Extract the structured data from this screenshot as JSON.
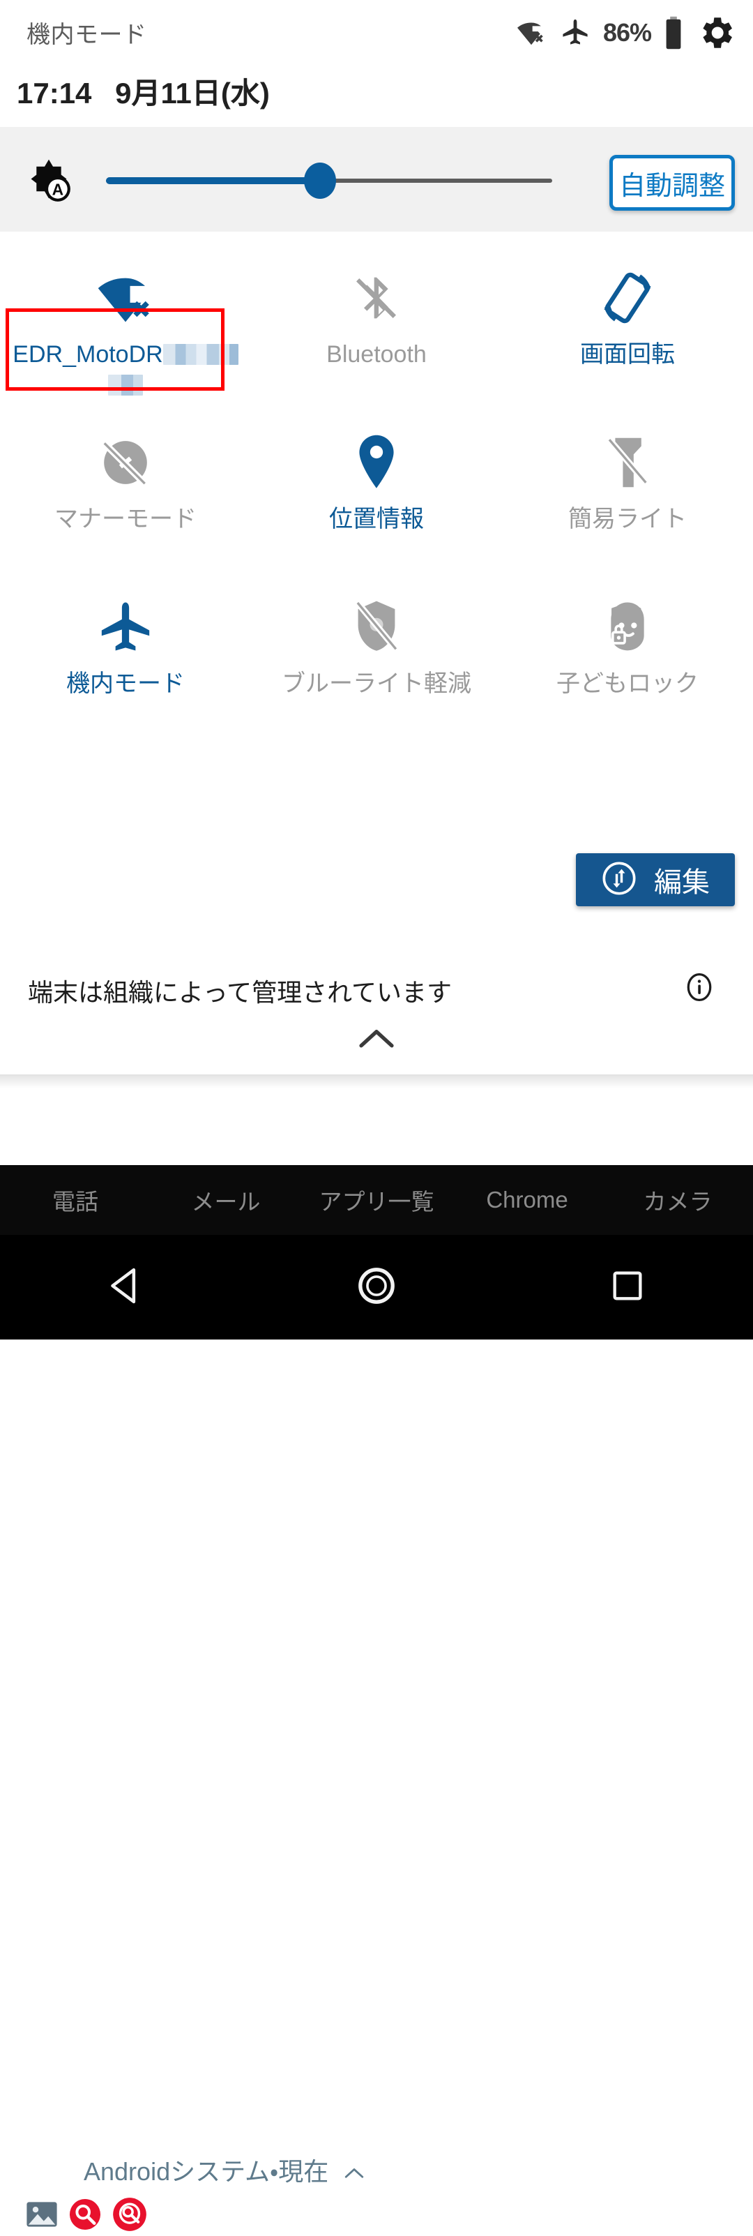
{
  "status_bar": {
    "left_label": "機内モード",
    "battery_percent": "86%",
    "icons": [
      "wifi-off-icon",
      "airplane-icon",
      "battery-icon",
      "gear-icon"
    ]
  },
  "clock": {
    "time": "17:14",
    "date": "9月11日(水)"
  },
  "brightness": {
    "icon": "auto-brightness-icon",
    "slider_value": 48,
    "auto_button_label": "自動調整"
  },
  "colors": {
    "accent_blue": "#0d5a96",
    "accent_blue_light": "#0d7ac4",
    "edit_button_blue": "#15568f",
    "off_gray": "#9a9a9a",
    "panel_gray": "#f1f1f1",
    "highlight_red": "#ff0000"
  },
  "tiles": [
    {
      "name": "wifi",
      "icon": "wifi-off-icon",
      "label": "EDR_MotoDR",
      "redacted": true,
      "state": "on",
      "highlighted": true
    },
    {
      "name": "bluetooth",
      "icon": "bluetooth-off-icon",
      "label": "Bluetooth",
      "state": "off",
      "highlighted": false
    },
    {
      "name": "auto-rotate",
      "icon": "screen-rotation-icon",
      "label": "画面回転",
      "state": "on",
      "highlighted": false
    },
    {
      "name": "silent-mode",
      "icon": "bell-off-icon",
      "label": "マナーモード",
      "state": "off",
      "highlighted": false
    },
    {
      "name": "location",
      "icon": "location-pin-icon",
      "label": "位置情報",
      "state": "on",
      "highlighted": false
    },
    {
      "name": "flashlight",
      "icon": "flashlight-off-icon",
      "label": "簡易ライト",
      "state": "off",
      "highlighted": false
    },
    {
      "name": "airplane-mode",
      "icon": "airplane-icon",
      "label": "機内モード",
      "state": "on",
      "highlighted": false
    },
    {
      "name": "blue-light-filter",
      "icon": "shield-off-icon",
      "label": "ブルーライト軽減",
      "state": "off",
      "highlighted": false
    },
    {
      "name": "child-lock",
      "icon": "child-lock-icon",
      "label": "子どもロック",
      "state": "off",
      "highlighted": false
    }
  ],
  "edit_button": {
    "label": "編集",
    "icon": "swap-vert-icon"
  },
  "footer": {
    "management_message": "端末は組織によって管理されています",
    "info_icon": "info-icon",
    "collapse_icon": "chevron-up-icon"
  },
  "notification": {
    "title": "Androidシステム・現在",
    "expand_icon": "chevron-up-icon",
    "app_icons": [
      "image-icon",
      "search-red-icon",
      "search-red-alt-icon"
    ]
  },
  "dock": {
    "items": [
      "電話",
      "メール",
      "アプリ一覧",
      "Chrome",
      "カメラ"
    ]
  },
  "navbar": {
    "items": [
      {
        "name": "back",
        "icon": "triangle-back-icon"
      },
      {
        "name": "home",
        "icon": "circle-home-icon"
      },
      {
        "name": "recents",
        "icon": "square-recents-icon"
      }
    ]
  }
}
